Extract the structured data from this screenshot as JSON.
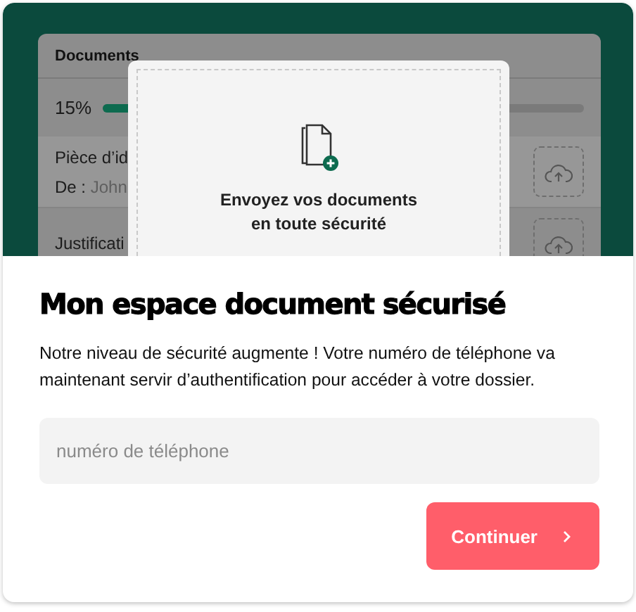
{
  "hero": {
    "panel": {
      "title": "Documents",
      "progress": {
        "reading": "15%",
        "level": 0.15
      },
      "rows": [
        {
          "name": "Pièce d’id",
          "from_label": "De :",
          "from_value": "John"
        },
        {
          "name": "Justificati"
        }
      ]
    },
    "dropzone": {
      "lines": [
        "Envoyez vos documents",
        "en toute sécurité"
      ]
    }
  },
  "title": "Mon espace document sécurisé",
  "description": "Notre niveau de sécurité augmente ! Votre numéro de téléphone va maintenant servir d’authentification pour accéder à votre dossier.",
  "phone_field": {
    "placeholder": "numéro de téléphone"
  },
  "button": {
    "label": "Continuer"
  }
}
